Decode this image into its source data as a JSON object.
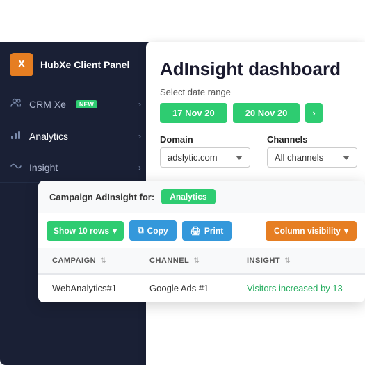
{
  "topbar": {
    "visible": false
  },
  "sidebar": {
    "app_name": "HubXe Client Panel",
    "logo_text": "X",
    "items": [
      {
        "id": "crm",
        "label": "CRM Xe",
        "badge": "NEW",
        "icon": "👥"
      },
      {
        "id": "analytics",
        "label": "Analytics",
        "icon": "📊"
      },
      {
        "id": "insight",
        "label": "Insight",
        "icon": "〜",
        "active": true
      }
    ]
  },
  "dashboard": {
    "title": "AdInsight dashboard",
    "date_range_label": "Select date range",
    "date_start": "17 Nov 20",
    "date_end": "20 Nov 20",
    "domain_label": "Domain",
    "domain_value": "adslytic.com",
    "channels_label": "Channels",
    "channels_value": "All channels"
  },
  "campaign_panel": {
    "title": "Campaign AdInsight for:",
    "badge": "Analytics",
    "toolbar": {
      "show_rows_label": "Show 10 rows",
      "copy_label": "Copy",
      "print_label": "Print",
      "col_visibility_label": "Column visibility"
    },
    "table": {
      "columns": [
        {
          "id": "campaign",
          "label": "CAMPAIGN"
        },
        {
          "id": "channel",
          "label": "CHANNEL"
        },
        {
          "id": "insight",
          "label": "INSIGHT"
        }
      ],
      "rows": [
        {
          "campaign": "WebAnalytics#1",
          "channel": "Google Ads #1",
          "insight": "Visitors increased by 13"
        }
      ]
    }
  }
}
